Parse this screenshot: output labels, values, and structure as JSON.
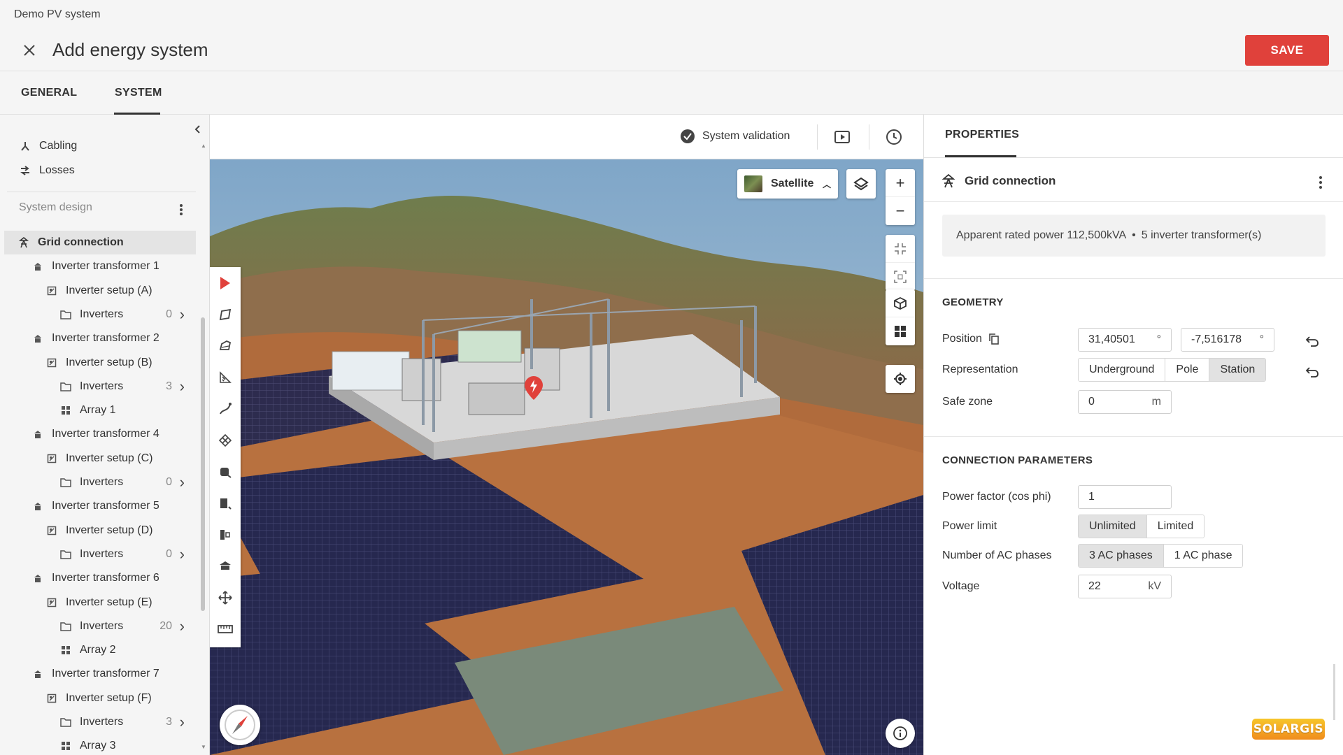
{
  "header": {
    "project_name": "Demo PV system",
    "title": "Add energy system",
    "save_label": "SAVE"
  },
  "tabs": [
    {
      "label": "GENERAL",
      "active": false
    },
    {
      "label": "SYSTEM",
      "active": true
    }
  ],
  "sidebar": {
    "links": [
      {
        "label": "Cabling",
        "icon": "cabling-icon"
      },
      {
        "label": "Losses",
        "icon": "losses-icon"
      }
    ],
    "section_label": "System design",
    "tree": [
      {
        "label": "Grid connection",
        "icon": "grid-connection-icon",
        "level": 0,
        "selected": true
      },
      {
        "label": "Inverter transformer 1",
        "icon": "transformer-icon",
        "level": 1
      },
      {
        "label": "Inverter setup (A)",
        "icon": "inverter-setup-icon",
        "level": 2
      },
      {
        "label": "Inverters",
        "icon": "folder-icon",
        "level": 3,
        "count": "0"
      },
      {
        "label": "Inverter transformer 2",
        "icon": "transformer-icon",
        "level": 1
      },
      {
        "label": "Inverter setup (B)",
        "icon": "inverter-setup-icon",
        "level": 2
      },
      {
        "label": "Inverters",
        "icon": "folder-icon",
        "level": 3,
        "count": "3"
      },
      {
        "label": "Array 1",
        "icon": "array-icon",
        "level": 3
      },
      {
        "label": "Inverter transformer 4",
        "icon": "transformer-icon",
        "level": 1
      },
      {
        "label": "Inverter setup (C)",
        "icon": "inverter-setup-icon",
        "level": 2
      },
      {
        "label": "Inverters",
        "icon": "folder-icon",
        "level": 3,
        "count": "0"
      },
      {
        "label": "Inverter transformer 5",
        "icon": "transformer-icon",
        "level": 1
      },
      {
        "label": "Inverter setup (D)",
        "icon": "inverter-setup-icon",
        "level": 2
      },
      {
        "label": "Inverters",
        "icon": "folder-icon",
        "level": 3,
        "count": "0"
      },
      {
        "label": "Inverter transformer 6",
        "icon": "transformer-icon",
        "level": 1
      },
      {
        "label": "Inverter setup (E)",
        "icon": "inverter-setup-icon",
        "level": 2
      },
      {
        "label": "Inverters",
        "icon": "folder-icon",
        "level": 3,
        "count": "20"
      },
      {
        "label": "Array 2",
        "icon": "array-icon",
        "level": 3
      },
      {
        "label": "Inverter transformer 7",
        "icon": "transformer-icon",
        "level": 1
      },
      {
        "label": "Inverter setup (F)",
        "icon": "inverter-setup-icon",
        "level": 2
      },
      {
        "label": "Inverters",
        "icon": "folder-icon",
        "level": 3,
        "count": "3"
      },
      {
        "label": "Array 3",
        "icon": "array-icon",
        "level": 3
      }
    ]
  },
  "map_toolbar": {
    "validation_label": "System validation"
  },
  "map": {
    "basemap_label": "Satellite"
  },
  "properties": {
    "tab_label": "PROPERTIES",
    "component_title": "Grid connection",
    "summary_power": "Apparent rated power 112,500kVA",
    "summary_sep": "•",
    "summary_transformers": "5 inverter transformer(s)",
    "geometry": {
      "title": "GEOMETRY",
      "position_label": "Position",
      "lat": "31,40501",
      "lon": "-7,516178",
      "degree_unit": "°",
      "representation_label": "Representation",
      "representation_options": [
        "Underground",
        "Pole",
        "Station"
      ],
      "representation_selected": "Station",
      "safe_zone_label": "Safe zone",
      "safe_zone_value": "0",
      "safe_zone_unit": "m"
    },
    "connection": {
      "title": "CONNECTION PARAMETERS",
      "power_factor_label": "Power factor (cos phi)",
      "power_factor_value": "1",
      "power_limit_label": "Power limit",
      "power_limit_options": [
        "Unlimited",
        "Limited"
      ],
      "power_limit_selected": "Unlimited",
      "phases_label": "Number of AC phases",
      "phases_options": [
        "3 AC phases",
        "1 AC phase"
      ],
      "phases_selected": "3 AC phases",
      "voltage_label": "Voltage",
      "voltage_value": "22",
      "voltage_unit": "kV"
    }
  },
  "brand": {
    "logo_text": "SOLARGIS",
    "accent_color": "#e0413b"
  }
}
